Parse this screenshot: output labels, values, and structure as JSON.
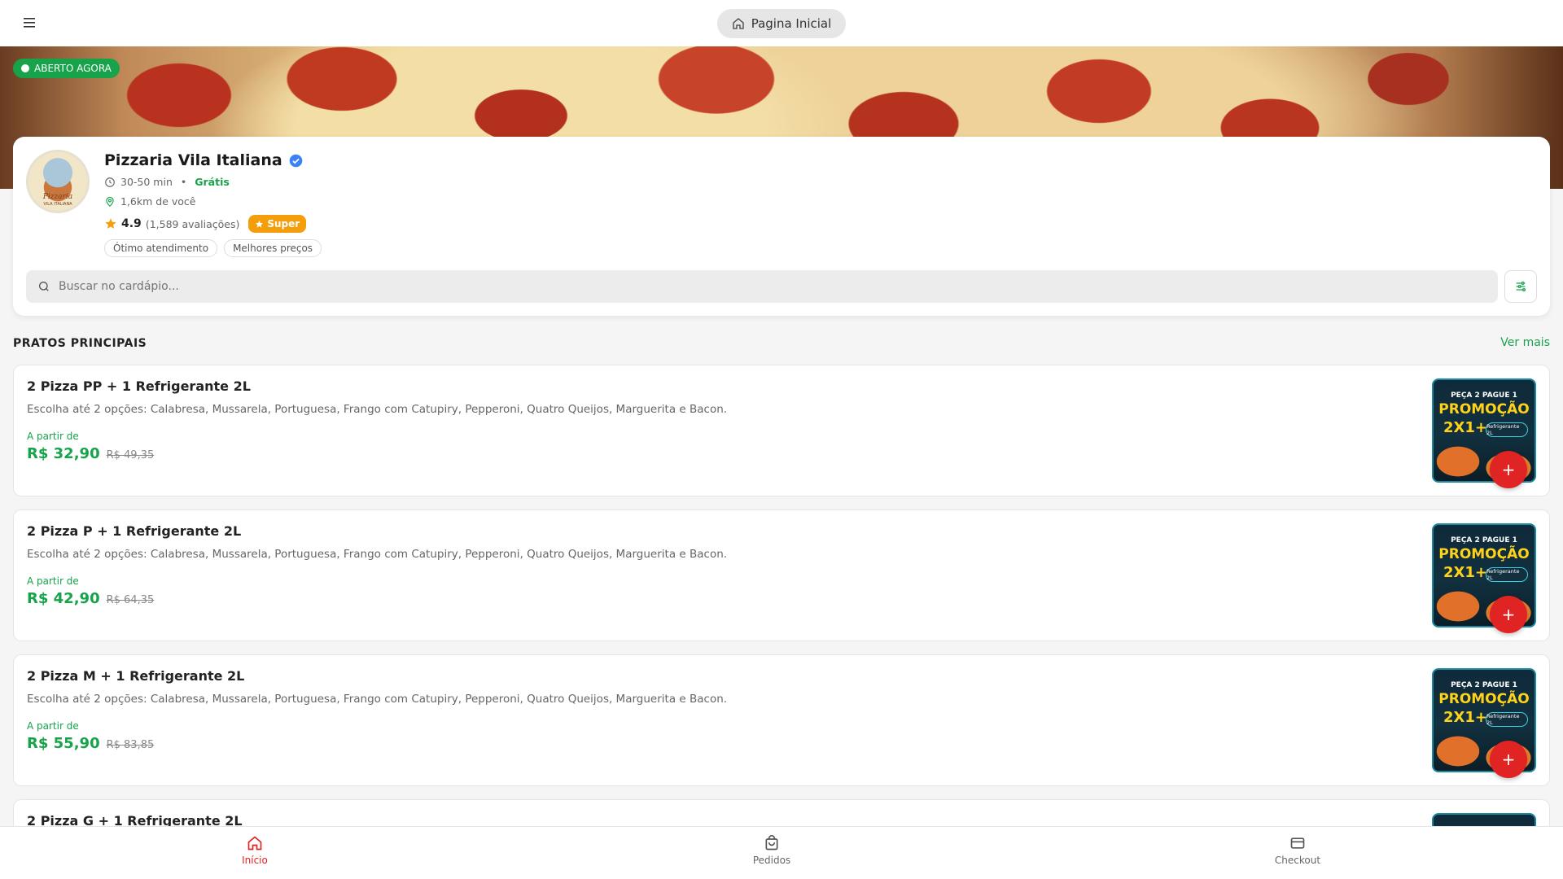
{
  "header": {
    "home_label": "Pagina Inicial"
  },
  "hero": {
    "open_badge": "ABERTO AGORA"
  },
  "store": {
    "name": "Pizzaria Vila Italiana",
    "logo_text": "Pizzaria",
    "logo_subtext": "VILA ITALIANA",
    "delivery_time": "30-50 min",
    "separator": "•",
    "delivery_fee": "Grátis",
    "distance": "1,6km de você",
    "rating": "4.9",
    "reviews": "(1,589 avaliações)",
    "super_badge": "Super",
    "tags": [
      "Ótimo atendimento",
      "Melhores preços"
    ]
  },
  "search": {
    "placeholder": "Buscar no cardápio..."
  },
  "section": {
    "title": "PRATOS PRINCIPAIS",
    "see_more": "Ver mais"
  },
  "promo_image": {
    "line1": "PEÇA 2 PAGUE 1",
    "line2": "PROMOÇÃO",
    "line3": "2X1+",
    "line4": "Refrigerante 2L"
  },
  "products": [
    {
      "title": "2 Pizza PP + 1 Refrigerante 2L",
      "description": "Escolha até 2 opções: Calabresa, Mussarela, Portuguesa, Frango com Catupiry, Pepperoni, Quatro Queijos, Marguerita e Bacon.",
      "from_label": "A partir de",
      "price": "R$ 32,90",
      "old_price": "R$ 49,35"
    },
    {
      "title": "2 Pizza P + 1 Refrigerante 2L",
      "description": "Escolha até 2 opções: Calabresa, Mussarela, Portuguesa, Frango com Catupiry, Pepperoni, Quatro Queijos, Marguerita e Bacon.",
      "from_label": "A partir de",
      "price": "R$ 42,90",
      "old_price": "R$ 64,35"
    },
    {
      "title": "2 Pizza M + 1 Refrigerante 2L",
      "description": "Escolha até 2 opções: Calabresa, Mussarela, Portuguesa, Frango com Catupiry, Pepperoni, Quatro Queijos, Marguerita e Bacon.",
      "from_label": "A partir de",
      "price": "R$ 55,90",
      "old_price": "R$ 83,85"
    },
    {
      "title": "2 Pizza G + 1 Refrigerante 2L"
    }
  ],
  "add_button": "+",
  "bottom_nav": [
    {
      "label": "Início",
      "icon": "home-icon",
      "active": true
    },
    {
      "label": "Pedidos",
      "icon": "bag-icon",
      "active": false
    },
    {
      "label": "Checkout",
      "icon": "card-icon",
      "active": false
    }
  ],
  "colors": {
    "accent_green": "#16a34a",
    "accent_red": "#e02424",
    "super_orange": "#f59e0b",
    "verified_blue": "#3b82f6"
  }
}
